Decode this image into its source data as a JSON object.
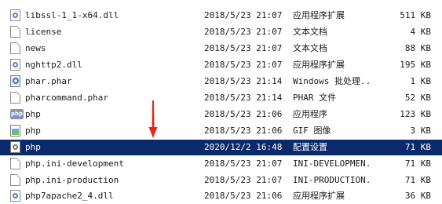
{
  "files": [
    {
      "name": "libssl-1_1-x64.dll",
      "date": "2018/5/23 21:07",
      "type": "应用程序扩展",
      "size": "511 KB",
      "icon": "dll-icon",
      "selected": false
    },
    {
      "name": "license",
      "date": "2018/5/23 21:07",
      "type": "文本文档",
      "size": "4 KB",
      "icon": "document-icon",
      "selected": false
    },
    {
      "name": "news",
      "date": "2018/5/23 21:07",
      "type": "文本文档",
      "size": "88 KB",
      "icon": "document-icon",
      "selected": false
    },
    {
      "name": "nghttp2.dll",
      "date": "2018/5/23 21:07",
      "type": "应用程序扩展",
      "size": "195 KB",
      "icon": "dll-icon",
      "selected": false
    },
    {
      "name": "phar.phar",
      "date": "2018/5/23 21:14",
      "type": "Windows 批处理...",
      "size": "1 KB",
      "icon": "phar-icon",
      "selected": false
    },
    {
      "name": "pharcommand.phar",
      "date": "2018/5/23 21:14",
      "type": "PHAR 文件",
      "size": "52 KB",
      "icon": "document-icon",
      "selected": false
    },
    {
      "name": "php",
      "date": "2018/5/23 21:06",
      "type": "应用程序",
      "size": "123 KB",
      "icon": "php-application-icon",
      "selected": false
    },
    {
      "name": "php",
      "date": "2018/5/23 21:06",
      "type": "GIF 图像",
      "size": "3 KB",
      "icon": "image-icon",
      "selected": false
    },
    {
      "name": "php",
      "date": "2020/12/2 16:48",
      "type": "配置设置",
      "size": "71 KB",
      "icon": "config-icon",
      "selected": true
    },
    {
      "name": "php.ini-development",
      "date": "2018/5/23 21:07",
      "type": "INI-DEVELOPMEN...",
      "size": "71 KB",
      "icon": "document-icon",
      "selected": false
    },
    {
      "name": "php.ini-production",
      "date": "2018/5/23 21:07",
      "type": "INI-PRODUCTION...",
      "size": "71 KB",
      "icon": "document-icon",
      "selected": false
    },
    {
      "name": "php7apache2_4.dll",
      "date": "2018/5/23 21:06",
      "type": "应用程序扩展",
      "size": "36 KB",
      "icon": "dll-icon",
      "selected": false
    }
  ],
  "colors": {
    "selection_background": "#0a2a6b",
    "selection_text": "#ffffff",
    "annotation_arrow": "#e8261c"
  }
}
